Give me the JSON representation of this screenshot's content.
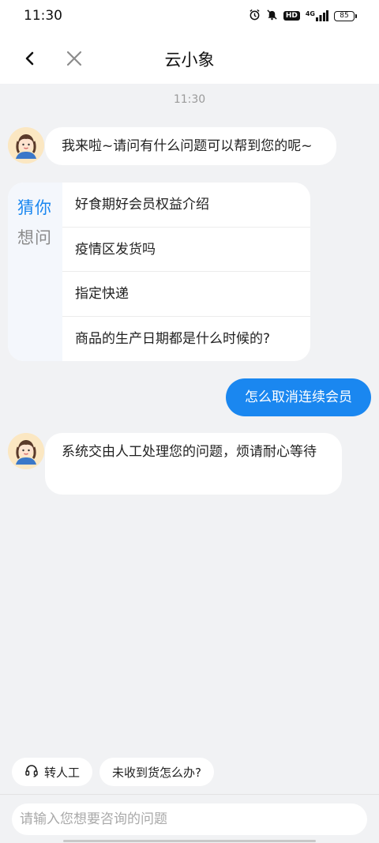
{
  "status_bar": {
    "time": "11:30",
    "hd_label": "HD",
    "signal_label": "4G",
    "battery": "85"
  },
  "header": {
    "title": "云小象"
  },
  "chat": {
    "timestamp": "11:30",
    "messages": [
      {
        "from": "bot",
        "text": "我来啦~请问有什么问题可以帮到您的呢~"
      },
      {
        "from": "user",
        "text": "怎么取消连续会员"
      },
      {
        "from": "bot",
        "text": "系统交由人工处理您的问题，烦请耐心等待"
      }
    ],
    "guess": {
      "title_line1": "猜你",
      "title_line2": "想问",
      "items": [
        "好食期好会员权益介绍",
        "疫情区发货吗",
        "指定快递",
        "商品的生产日期都是什么时候的?"
      ]
    }
  },
  "quick_replies": {
    "human": "转人工",
    "not_received": "未收到货怎么办?"
  },
  "input": {
    "placeholder": "请输入您想要咨询的问题"
  },
  "colors": {
    "accent": "#1a87f0",
    "background": "#f1f2f4"
  }
}
